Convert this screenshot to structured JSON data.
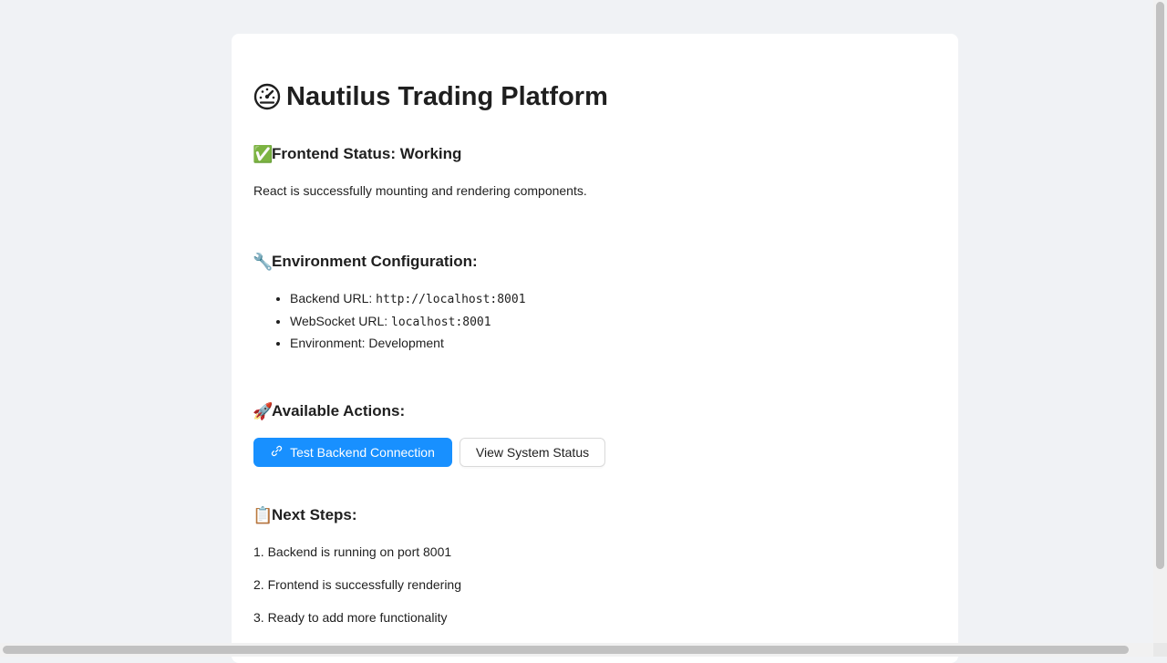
{
  "title": {
    "icon": "dashboard-icon",
    "text": "Nautilus Trading Platform"
  },
  "frontend": {
    "icon": "✅",
    "heading": "Frontend Status: Working",
    "description": "React is successfully mounting and rendering components."
  },
  "environment": {
    "icon": "🔧",
    "heading": "Environment Configuration:",
    "items": [
      {
        "label": "Backend URL: ",
        "value": "http://localhost:8001"
      },
      {
        "label": "WebSocket URL: ",
        "value": "localhost:8001"
      },
      {
        "label": "Environment: Development",
        "value": ""
      }
    ]
  },
  "actions": {
    "icon": "🚀",
    "heading": "Available Actions:",
    "test_button": {
      "icon": "link-icon",
      "label": "Test Backend Connection"
    },
    "status_button": {
      "label": "View System Status"
    }
  },
  "next_steps": {
    "icon": "📋",
    "heading": "Next Steps:",
    "steps": [
      "1. Backend is running on port 8001",
      "2. Frontend is successfully rendering",
      "3. Ready to add more functionality"
    ]
  },
  "colors": {
    "primary": "#1890ff",
    "background": "#f0f2f5",
    "card": "#ffffff"
  }
}
